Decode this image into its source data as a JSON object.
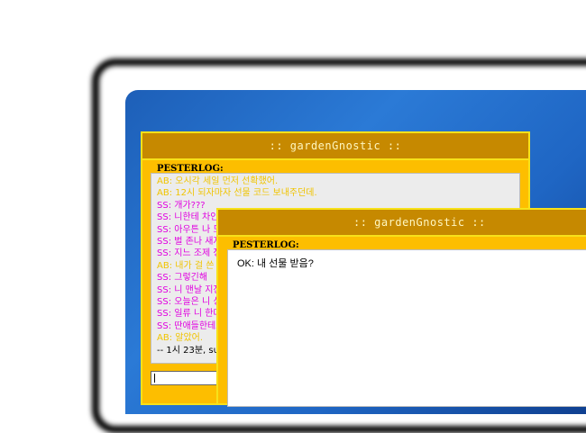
{
  "window_back": {
    "title": ":: gardenGnostic ::",
    "pesterlog_label": "PESTERLOG:",
    "lines": [
      {
        "who": "ab",
        "text": "AB: 오시각 세일 먼저 선확했어."
      },
      {
        "who": "ab",
        "text": "AB: 12시 되자마자 선물 코드 보내주던데."
      },
      {
        "who": "ss",
        "text": "SS: 개가???"
      },
      {
        "who": "ss",
        "text": "SS: 니한테 차인"
      },
      {
        "who": "ss",
        "text": "SS: 아우튼 나 모"
      },
      {
        "who": "ss",
        "text": "SS: 벌 존나 새지"
      },
      {
        "who": "ss",
        "text": "SS: 지느 조제 정"
      },
      {
        "who": "ab",
        "text": "AB: 내가 걸 쓴"
      },
      {
        "who": "ss",
        "text": "SS: 그렇긴해"
      },
      {
        "who": "ss",
        "text": "SS: 니 맨날 지진"
      },
      {
        "who": "ss",
        "text": "SS: 오늘은 니 싱"
      },
      {
        "who": "ss",
        "text": "SS: 일류 니 한다"
      },
      {
        "who": "ss",
        "text": "SS: 딴애들한테도"
      },
      {
        "who": "ab",
        "text": "AB: 알았어."
      },
      {
        "who": "sys",
        "text": "-- 1시 23분, sup"
      }
    ]
  },
  "window_front": {
    "title": ":: gardenGnostic ::",
    "pesterlog_label": "PESTERLOG:",
    "message": "OK: 내 선물 받음?"
  },
  "colors": {
    "window_bg": "#fdbe00",
    "titlebar": "#c68900",
    "ab_text": "#f0c400",
    "ss_text": "#e000e0",
    "desktop": "#2b7ad6"
  }
}
